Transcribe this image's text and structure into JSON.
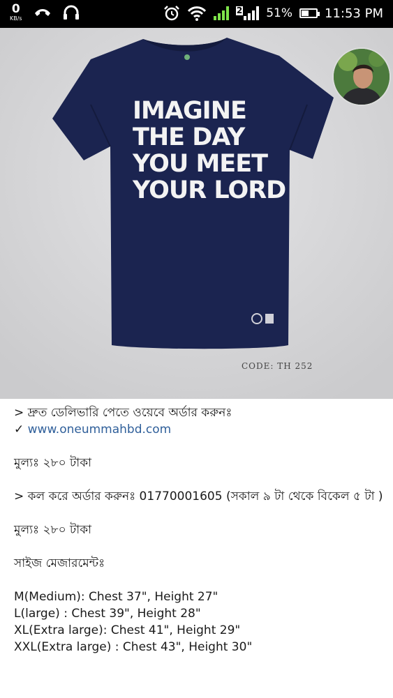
{
  "status_bar": {
    "net_speed_value": "0",
    "net_speed_unit": "KB/s",
    "sim2_label": "2",
    "battery": "51%",
    "time": "11:53 PM",
    "battery_level": 0.51
  },
  "product": {
    "slogan_lines": [
      "IMAGINE",
      "THE DAY",
      "YOU MEET",
      "YOUR LORD"
    ],
    "code": "CODE:  TH 252"
  },
  "post": {
    "line1": "> দ্রুত ডেলিভারি পেতে ওয়েবে অর্ডার করুনঃ",
    "link_prefix": "✓ ",
    "link": "www.oneummahbd.com",
    "price1": "মুল্যঃ ২৮০ টাকা",
    "call": "> কল করে অর্ডার করুনঃ 01770001605 (সকাল ৯ টা থেকে বিকেল ৫ টা )",
    "price2": "মুল্যঃ ২৮০ টাকা",
    "size_heading": "সাইজ মেজারমেন্টঃ",
    "sizes": [
      "M(Medium): Chest 37\", Height 27\"",
      "L(large) : Chest 39\", Height 28\"",
      "XL(Extra large): Chest 41\", Height 29\"",
      "XXL(Extra large) : Chest 43\", Height 30\""
    ]
  }
}
